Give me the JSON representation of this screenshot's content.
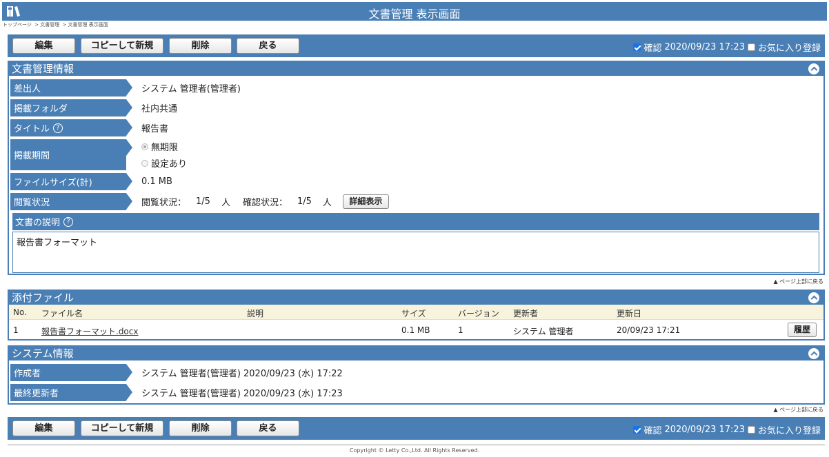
{
  "window": {
    "title": "文書管理 表示画面",
    "app_icon": "book-library-icon"
  },
  "breadcrumb": [
    "トップページ",
    "> 文書管理",
    "> 文書管理 表示画面"
  ],
  "toolbar": {
    "edit_label": "編集",
    "copy_new_label": "コピーして新規",
    "delete_label": "削除",
    "back_label": "戻る",
    "confirm_label": "確認",
    "confirm_checked": true,
    "confirm_datetime": "2020/09/23 17:23",
    "favorite_label": "お気に入り登録",
    "favorite_checked": false
  },
  "doc_info": {
    "heading": "文書管理情報",
    "sender_label": "差出人",
    "sender_value": "システム 管理者(管理者)",
    "folder_label": "掲載フォルダ",
    "folder_value": "社内共通",
    "title_label": "タイトル",
    "title_value": "報告書",
    "period_label": "掲載期間",
    "period_options": [
      "無期限",
      "設定あり"
    ],
    "period_selected": "無期限",
    "filesize_label": "ファイルサイズ(計)",
    "filesize_value": "0.1 MB",
    "view_status_label": "閲覧状況",
    "view_status_text": "閲覧状況：",
    "view_count": "1/5",
    "view_unit": "人",
    "confirm_status_text": "確認状況：",
    "confirm_count": "1/5",
    "confirm_unit": "人",
    "detail_button": "詳細表示",
    "description_label": "文書の説明",
    "description_value": "報告書フォーマット"
  },
  "page_top_link": "▲ ページ上部に戻る",
  "attachments": {
    "heading": "添付ファイル",
    "columns": [
      "No.",
      "ファイル名",
      "説明",
      "サイズ",
      "バージョン",
      "更新者",
      "更新日"
    ],
    "rows": [
      {
        "no": "1",
        "file_name": "報告書フォーマット.docx",
        "description": "",
        "size": "0.1 MB",
        "version": "1",
        "updater": "システム 管理者",
        "updated": "20/09/23 17:21",
        "history_button": "履歴"
      }
    ]
  },
  "system_info": {
    "heading": "システム情報",
    "creator_label": "作成者",
    "creator_value": "システム 管理者(管理者) 2020/09/23 (水) 17:22",
    "last_updater_label": "最終更新者",
    "last_updater_value": "システム 管理者(管理者) 2020/09/23 (水) 17:23"
  },
  "footer": {
    "copyright": "Copyright © Letty Co.,Ltd. All Rights Reserved."
  },
  "colors": {
    "header_blue": "#4a7fb5",
    "table_header_bg": "#f7f3dc"
  }
}
